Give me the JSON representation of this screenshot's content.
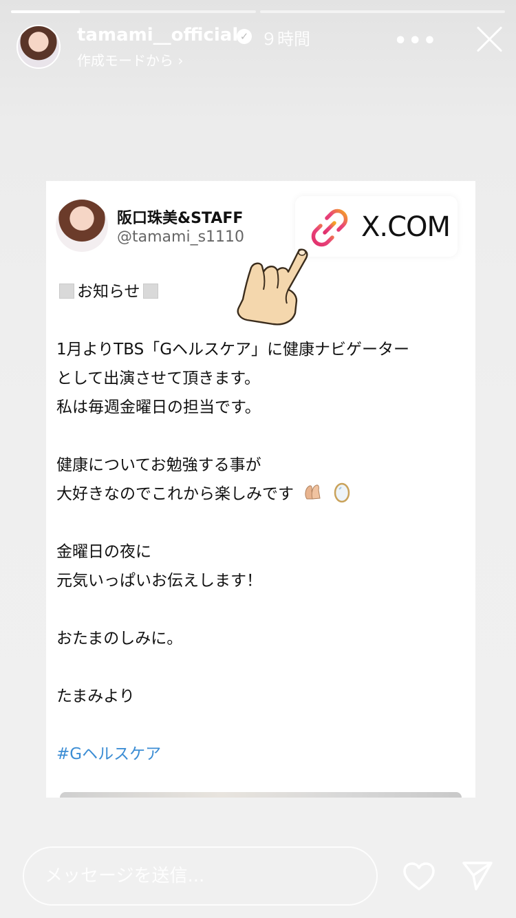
{
  "progress": {
    "segments": [
      {
        "name": "story-1",
        "fraction": 0.28
      },
      {
        "name": "story-2",
        "fraction": 0.0
      }
    ]
  },
  "header": {
    "username": "tamami__official",
    "time": "９時間",
    "mode": "作成モードから ›",
    "more_label": "•••"
  },
  "card": {
    "display_name": "阪口珠美&STAFF",
    "handle": "@tamami_s1110",
    "link_sticker": "X.COM",
    "notice_label": "お知らせ",
    "lines": [
      "1月よりTBS「Gヘルスケア」に健康ナビゲーター",
      "として出演させて頂きます。",
      "私は毎週金曜日の担当です。",
      "健康についてお勉強する事が",
      "大好きなのでこれから楽しみです",
      "金曜日の夜に",
      "元気いっぱいお伝えします！",
      "おたまのしみに。",
      "たまみより"
    ],
    "hashtag": "#Gヘルスケア"
  },
  "composer": {
    "placeholder": "メッセージを送信..."
  },
  "icons": {
    "verified": "verified-badge-icon",
    "close": "close-icon",
    "link": "link-icon",
    "hand": "pointing-hand-icon",
    "heart": "heart-icon",
    "send": "send-icon"
  },
  "colors": {
    "hashtag": "#3c8dd4",
    "link_gradient_start": "#f5a623",
    "link_gradient_mid": "#e1306c",
    "link_gradient_end": "#833ab4"
  }
}
